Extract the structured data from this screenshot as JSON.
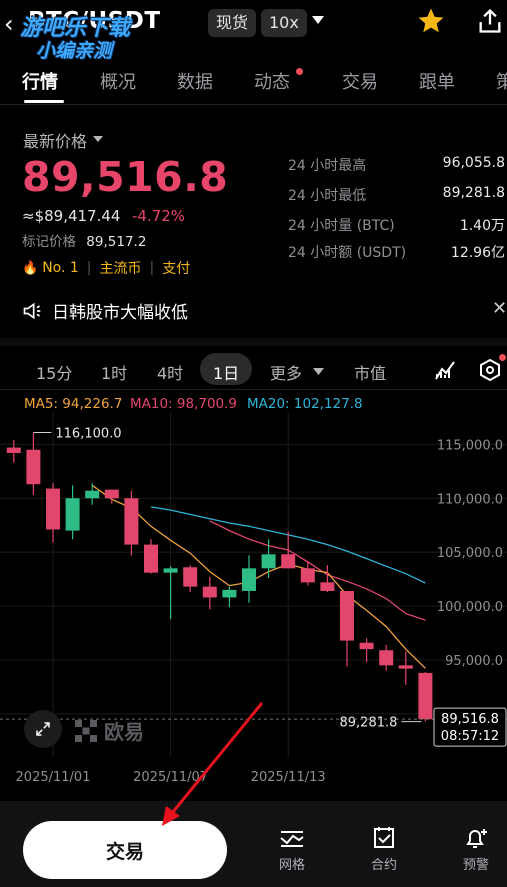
{
  "header": {
    "pair": "BTC/USDT",
    "spot_badge": "现货",
    "leverage_badge": "10x",
    "overlay_line1": "游吧乐下载",
    "overlay_line2": "小编亲测"
  },
  "tabs": [
    "行情",
    "概况",
    "数据",
    "动态",
    "交易",
    "跟单",
    "策"
  ],
  "price": {
    "label": "最新价格",
    "last": "89,516.8",
    "approx": "≈$89,417.44",
    "change": "-4.72%",
    "mark_label": "标记价格",
    "mark_value": "89,517.2",
    "rank": "No. 1",
    "tag1": "主流币",
    "tag2": "支付"
  },
  "stats": [
    {
      "label": "24 小时最高",
      "value": "96,055.8"
    },
    {
      "label": "24 小时最低",
      "value": "89,281.8"
    },
    {
      "label": "24 小时量 (BTC)",
      "value": "1.40万"
    },
    {
      "label": "24 小时额 (USDT)",
      "value": "12.96亿"
    }
  ],
  "news": {
    "text": "日韩股市大幅收低"
  },
  "intervals": [
    "15分",
    "1时",
    "4时",
    "1日",
    "更多",
    "市值"
  ],
  "ma_legend": [
    {
      "text": "MA5: 94,226.7",
      "color": "#f0a33a"
    },
    {
      "text": "MA10: 98,700.9",
      "color": "#e2466d"
    },
    {
      "text": "MA20: 102,127.8",
      "color": "#2fb4d8"
    }
  ],
  "colors": {
    "up": "#2ebd85",
    "down": "#e2466d",
    "accent_price": "#e8456b"
  },
  "chart_data": {
    "type": "candlestick",
    "y_ticks": [
      "115,000.0",
      "110,000.0",
      "105,000.0",
      "100,000.0",
      "95,000.0",
      "90,000.0"
    ],
    "y_range": [
      86000,
      118000
    ],
    "x_ticks": [
      {
        "index": 2,
        "label": "2025/11/01"
      },
      {
        "index": 8,
        "label": "2025/11/07"
      },
      {
        "index": 14,
        "label": "2025/11/13"
      }
    ],
    "candles": [
      {
        "o": 114700,
        "h": 115400,
        "l": 113300,
        "c": 114200
      },
      {
        "o": 114500,
        "h": 116100,
        "l": 110300,
        "c": 111300
      },
      {
        "o": 110900,
        "h": 111400,
        "l": 105900,
        "c": 107100
      },
      {
        "o": 107000,
        "h": 111200,
        "l": 106200,
        "c": 110000
      },
      {
        "o": 110000,
        "h": 111400,
        "l": 109400,
        "c": 110700
      },
      {
        "o": 110800,
        "h": 110800,
        "l": 109500,
        "c": 110000
      },
      {
        "o": 110000,
        "h": 110700,
        "l": 104700,
        "c": 105700
      },
      {
        "o": 105700,
        "h": 106200,
        "l": 103000,
        "c": 103100
      },
      {
        "o": 103100,
        "h": 103700,
        "l": 98800,
        "c": 103500
      },
      {
        "o": 103600,
        "h": 103800,
        "l": 101300,
        "c": 101800
      },
      {
        "o": 101800,
        "h": 102700,
        "l": 99700,
        "c": 100800
      },
      {
        "o": 100800,
        "h": 101800,
        "l": 99900,
        "c": 101500
      },
      {
        "o": 101400,
        "h": 104700,
        "l": 100300,
        "c": 103500
      },
      {
        "o": 103500,
        "h": 106200,
        "l": 102600,
        "c": 104800
      },
      {
        "o": 104800,
        "h": 106900,
        "l": 103500,
        "c": 103500
      },
      {
        "o": 103500,
        "h": 104200,
        "l": 101900,
        "c": 102200
      },
      {
        "o": 102200,
        "h": 103800,
        "l": 101300,
        "c": 101400
      },
      {
        "o": 101400,
        "h": 101400,
        "l": 94400,
        "c": 96800
      },
      {
        "o": 96600,
        "h": 97000,
        "l": 94800,
        "c": 96000
      },
      {
        "o": 95900,
        "h": 96400,
        "l": 94000,
        "c": 94500
      },
      {
        "o": 94500,
        "h": 95800,
        "l": 92700,
        "c": 94200
      },
      {
        "o": 93800,
        "h": 93900,
        "l": 89300,
        "c": 89500
      }
    ],
    "ma5": [
      null,
      null,
      null,
      null,
      111200,
      109900,
      109100,
      107400,
      106100,
      104900,
      103200,
      101900,
      102200,
      103200,
      103900,
      103400,
      103100,
      101000,
      99600,
      98100,
      96000,
      94226.7
    ],
    "ma10": [
      null,
      null,
      null,
      null,
      null,
      null,
      null,
      null,
      null,
      null,
      107900,
      107000,
      106200,
      105600,
      105200,
      104100,
      102900,
      102300,
      101600,
      100700,
      99300,
      98700.9
    ],
    "ma20": [
      109200,
      108900,
      108500,
      108100,
      107700,
      107400,
      107000,
      106600,
      106200,
      105700,
      105100,
      104400,
      103700,
      103000,
      102127.8
    ],
    "ma20_start_index": 7,
    "high_label": "116,100.0",
    "low_label": "89,281.8",
    "last_price_label": "89,516.8",
    "countdown": "08:57:12",
    "watermark": "欧易"
  },
  "bottom": {
    "trade": "交易",
    "grid": "网格",
    "contract": "合约",
    "alert": "预警"
  }
}
